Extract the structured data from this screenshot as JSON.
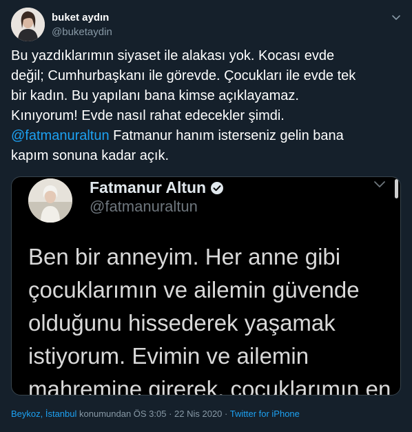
{
  "author": {
    "name": "buket aydın",
    "handle": "@buketaydin"
  },
  "tweet": {
    "lines": [
      "Bu yazdıklarımın siyaset ile alakası yok. Kocası evde",
      "değil; Cumhurbaşkanı ile görevde. Çocukları ile evde tek",
      "bir kadın. Bu yapılanı bana kimse açıklayamaz.",
      "Kınıyorum! Evde nasıl rahat edecekler şimdi."
    ],
    "mention": "@fatmanuraltun",
    "mention_rest": " Fatmanur hanım isterseniz gelin bana",
    "last_line": "kapım sonuna kadar açık."
  },
  "embedded": {
    "name": "Fatmanur Altun",
    "handle": "@fatmanuraltun",
    "lines": [
      "Ben bir anneyim. Her anne gibi",
      "çocuklarımın ve ailemin güvende",
      "olduğunu hissederek yaşamak",
      "istiyorum. Evimin ve ailemin",
      "mahremine girerek, çocuklarımın en"
    ]
  },
  "footer": {
    "location": "Beykoz, İstanbul",
    "location_suffix": " konumundan ÖS 3:05 · 22 Nis 2020 · ",
    "source": "Twitter for iPhone"
  },
  "colors": {
    "background": "#15202b",
    "accent": "#1da1f2",
    "secondary_text": "#8899a6"
  },
  "icons": [
    "chevron-down-icon",
    "verified-badge-icon"
  ]
}
